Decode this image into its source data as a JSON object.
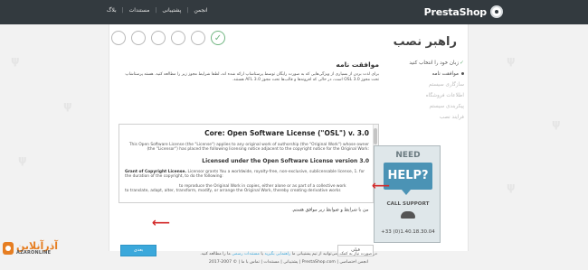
{
  "topbar": {
    "brand": "PrestaShop",
    "nav": [
      "انجمن",
      "پشتیبانی",
      "مستندات",
      "بلاگ"
    ]
  },
  "wizard": {
    "title": "راهبر نصب",
    "steps_total": 6,
    "steps_completed": 1
  },
  "sidebar": {
    "items": [
      {
        "label": "زبان خود را انتخاب کنید",
        "state": "done"
      },
      {
        "label": "موافقت نامه",
        "state": "active"
      },
      {
        "label": "سازگاری سیستم",
        "state": "pending"
      },
      {
        "label": "اطلاعات فروشگاه",
        "state": "pending"
      },
      {
        "label": "پیکربندی سیستم",
        "state": "pending"
      },
      {
        "label": "فرایند نصب",
        "state": "pending"
      }
    ]
  },
  "content": {
    "title": "موافقت نامه",
    "intro": "برای لذت بردن از بسیاری از ویژگی‌هایی که به صورت رایگان توسط پرستاشاپ ارائه شده اند، لطفا شرایط مجوز زیر را مطالعه کنید. هسته پرستاشاپ تحت مجوز OSL 3.0 است، در حالی که افزونه‌ها و قالب‌ها تحت مجوز AFL 3.0 هستند."
  },
  "license": {
    "heading": "Core: Open Software License (\"OSL\") v. 3.0",
    "para1": "This Open Software License (the \"License\") applies to any original work of authorship (the \"Original Work\") whose owner (the \"Licensor\") has placed the following licensing notice adjacent to the copyright notice for the Original Work:",
    "subheading": "Licensed under the Open Software License version 3.0",
    "grant_label": "Grant of Copyright License.",
    "grant_text": "Licensor grants You a worldwide, royalty-free, non-exclusive, sublicensable license, 1. for the duration of the copyright, to do the following:",
    "item_a": "to reproduce the Original Work in copies, either alone or as part of a collective work",
    "item_b": "to translate, adapt, alter, transform, modify, or arrange the Original Work, thereby creating derivative works"
  },
  "accept": {
    "label": "من با شرایط و ضوابط زیر موافق هستم.",
    "checked": false
  },
  "buttons": {
    "next": "بعدی",
    "back": "قبلی"
  },
  "help_ad": {
    "need": "NEED",
    "help": "HELP?",
    "call": "CALL SUPPORT",
    "phone": "+33 (0)1.40.18.30.04"
  },
  "footer": {
    "note_prefix": "در صورت نیاز به کمک، می‌توانید از تیم پشتیبانی ما",
    "note_link1": "راهنمایی بگیرید",
    "note_mid": "یا",
    "note_link2": "مستندات رسمی",
    "note_suffix": "ما را مطالعه کنید.",
    "links": "انجمن اختصاصی | PrestaShop.com | پشتیبانی | مستندات | تماس با ما | © 2007-2017"
  },
  "watermark": {
    "brand": "AZARONLINE"
  }
}
